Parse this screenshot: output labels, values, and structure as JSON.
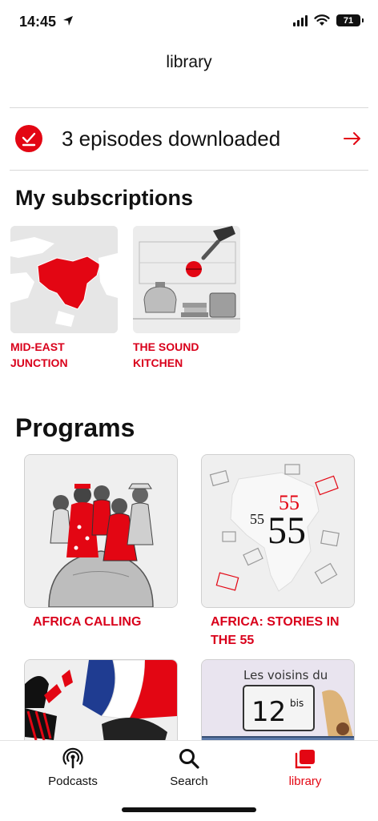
{
  "status": {
    "time": "14:45",
    "battery": "71"
  },
  "header": {
    "title": "library"
  },
  "downloads": {
    "label": "3 episodes downloaded"
  },
  "subscriptions": {
    "title": "My subscriptions",
    "items": [
      {
        "label_line1": "MID-EAST",
        "label_line2": "JUNCTION"
      },
      {
        "label_line1": "THE SOUND",
        "label_line2": "KITCHEN"
      }
    ]
  },
  "programs": {
    "title": "Programs",
    "items": [
      {
        "label_line1": "AFRICA CALLING",
        "label_line2": ""
      },
      {
        "label_line1": "AFRICA: STORIES IN",
        "label_line2": "THE 55",
        "art_small": "55",
        "art_large": "55",
        "art_top": "55"
      },
      {
        "label_line1": "",
        "label_line2": ""
      },
      {
        "label_line1": "",
        "label_line2": "",
        "art_title": "Les voisins du",
        "art_number": "12",
        "art_suffix": "bis"
      }
    ]
  },
  "tabs": [
    {
      "label": "Podcasts",
      "icon": "podcast-icon"
    },
    {
      "label": "Search",
      "icon": "search-icon"
    },
    {
      "label": "library",
      "icon": "library-icon",
      "active": true
    }
  ],
  "colors": {
    "accent": "#e30613",
    "label_red": "#d9001b"
  }
}
